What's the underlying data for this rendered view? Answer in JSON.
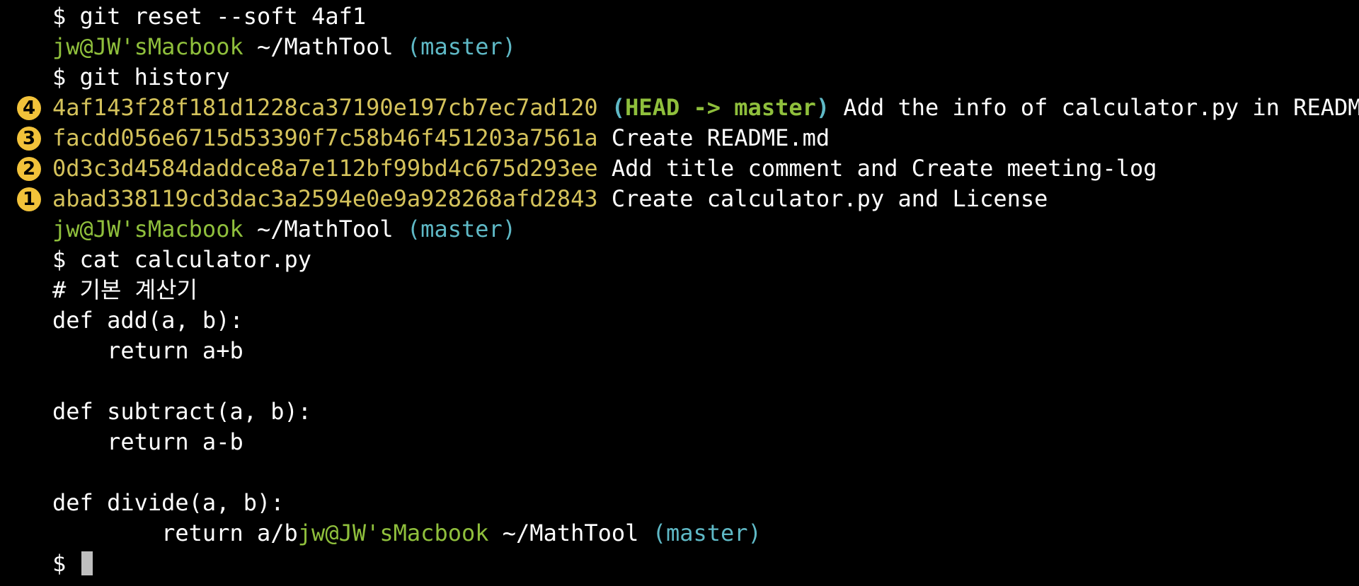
{
  "colors": {
    "background": "#000000",
    "text": "#ffffff",
    "prompt_user": "#8fbf3c",
    "prompt_branch": "#5fb9c6",
    "commit_hash": "#d4c25b",
    "marker": "#f2c23a",
    "cursor": "#bfbfbf"
  },
  "prompt": {
    "user": "jw@JW'sMacbook",
    "path": "~/MathTool",
    "branch": "(master)",
    "symbol": "$"
  },
  "commands": {
    "reset": "git reset --soft 4af1",
    "history": "git history",
    "cat": "cat calculator.py"
  },
  "commits": [
    {
      "marker": "4",
      "hash": "4af143f28f181d1228ca37190e197cb7ec7ad120",
      "ref_open": "(",
      "ref_head": "HEAD -> master",
      "ref_close": ")",
      "message": "Add the info of calculator.py in README.md"
    },
    {
      "marker": "3",
      "hash": "facdd056e6715d53390f7c58b46f451203a7561a",
      "message": "Create README.md"
    },
    {
      "marker": "2",
      "hash": "0d3c3d4584daddce8a7e112bf99bd4c675d293ee",
      "message": "Add title comment and Create meeting-log"
    },
    {
      "marker": "1",
      "hash": "abad338119cd3dac3a2594e0e9a928268afd2843",
      "message": "Create calculator.py and License"
    }
  ],
  "file_lines": [
    "# 기본 계산기",
    "def add(a, b):",
    "    return a+b",
    "",
    "def subtract(a, b):",
    "    return a-b",
    "",
    "def divide(a, b):"
  ],
  "last_code_line": "        return a/b"
}
